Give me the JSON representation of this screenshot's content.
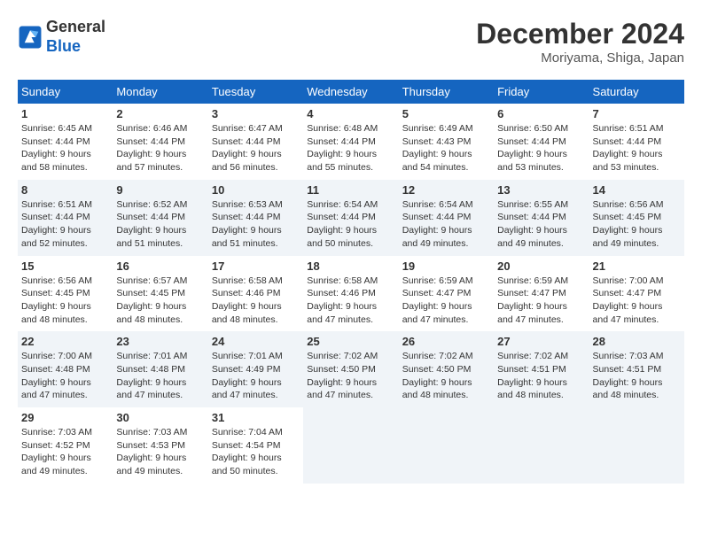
{
  "header": {
    "logo_line1": "General",
    "logo_line2": "Blue",
    "month_title": "December 2024",
    "location": "Moriyama, Shiga, Japan"
  },
  "weekdays": [
    "Sunday",
    "Monday",
    "Tuesday",
    "Wednesday",
    "Thursday",
    "Friday",
    "Saturday"
  ],
  "weeks": [
    [
      {
        "day": "1",
        "sunrise": "6:45 AM",
        "sunset": "4:44 PM",
        "daylight": "9 hours and 58 minutes."
      },
      {
        "day": "2",
        "sunrise": "6:46 AM",
        "sunset": "4:44 PM",
        "daylight": "9 hours and 57 minutes."
      },
      {
        "day": "3",
        "sunrise": "6:47 AM",
        "sunset": "4:44 PM",
        "daylight": "9 hours and 56 minutes."
      },
      {
        "day": "4",
        "sunrise": "6:48 AM",
        "sunset": "4:44 PM",
        "daylight": "9 hours and 55 minutes."
      },
      {
        "day": "5",
        "sunrise": "6:49 AM",
        "sunset": "4:43 PM",
        "daylight": "9 hours and 54 minutes."
      },
      {
        "day": "6",
        "sunrise": "6:50 AM",
        "sunset": "4:44 PM",
        "daylight": "9 hours and 53 minutes."
      },
      {
        "day": "7",
        "sunrise": "6:51 AM",
        "sunset": "4:44 PM",
        "daylight": "9 hours and 53 minutes."
      }
    ],
    [
      {
        "day": "8",
        "sunrise": "6:51 AM",
        "sunset": "4:44 PM",
        "daylight": "9 hours and 52 minutes."
      },
      {
        "day": "9",
        "sunrise": "6:52 AM",
        "sunset": "4:44 PM",
        "daylight": "9 hours and 51 minutes."
      },
      {
        "day": "10",
        "sunrise": "6:53 AM",
        "sunset": "4:44 PM",
        "daylight": "9 hours and 51 minutes."
      },
      {
        "day": "11",
        "sunrise": "6:54 AM",
        "sunset": "4:44 PM",
        "daylight": "9 hours and 50 minutes."
      },
      {
        "day": "12",
        "sunrise": "6:54 AM",
        "sunset": "4:44 PM",
        "daylight": "9 hours and 49 minutes."
      },
      {
        "day": "13",
        "sunrise": "6:55 AM",
        "sunset": "4:44 PM",
        "daylight": "9 hours and 49 minutes."
      },
      {
        "day": "14",
        "sunrise": "6:56 AM",
        "sunset": "4:45 PM",
        "daylight": "9 hours and 49 minutes."
      }
    ],
    [
      {
        "day": "15",
        "sunrise": "6:56 AM",
        "sunset": "4:45 PM",
        "daylight": "9 hours and 48 minutes."
      },
      {
        "day": "16",
        "sunrise": "6:57 AM",
        "sunset": "4:45 PM",
        "daylight": "9 hours and 48 minutes."
      },
      {
        "day": "17",
        "sunrise": "6:58 AM",
        "sunset": "4:46 PM",
        "daylight": "9 hours and 48 minutes."
      },
      {
        "day": "18",
        "sunrise": "6:58 AM",
        "sunset": "4:46 PM",
        "daylight": "9 hours and 47 minutes."
      },
      {
        "day": "19",
        "sunrise": "6:59 AM",
        "sunset": "4:47 PM",
        "daylight": "9 hours and 47 minutes."
      },
      {
        "day": "20",
        "sunrise": "6:59 AM",
        "sunset": "4:47 PM",
        "daylight": "9 hours and 47 minutes."
      },
      {
        "day": "21",
        "sunrise": "7:00 AM",
        "sunset": "4:47 PM",
        "daylight": "9 hours and 47 minutes."
      }
    ],
    [
      {
        "day": "22",
        "sunrise": "7:00 AM",
        "sunset": "4:48 PM",
        "daylight": "9 hours and 47 minutes."
      },
      {
        "day": "23",
        "sunrise": "7:01 AM",
        "sunset": "4:48 PM",
        "daylight": "9 hours and 47 minutes."
      },
      {
        "day": "24",
        "sunrise": "7:01 AM",
        "sunset": "4:49 PM",
        "daylight": "9 hours and 47 minutes."
      },
      {
        "day": "25",
        "sunrise": "7:02 AM",
        "sunset": "4:50 PM",
        "daylight": "9 hours and 47 minutes."
      },
      {
        "day": "26",
        "sunrise": "7:02 AM",
        "sunset": "4:50 PM",
        "daylight": "9 hours and 48 minutes."
      },
      {
        "day": "27",
        "sunrise": "7:02 AM",
        "sunset": "4:51 PM",
        "daylight": "9 hours and 48 minutes."
      },
      {
        "day": "28",
        "sunrise": "7:03 AM",
        "sunset": "4:51 PM",
        "daylight": "9 hours and 48 minutes."
      }
    ],
    [
      {
        "day": "29",
        "sunrise": "7:03 AM",
        "sunset": "4:52 PM",
        "daylight": "9 hours and 49 minutes."
      },
      {
        "day": "30",
        "sunrise": "7:03 AM",
        "sunset": "4:53 PM",
        "daylight": "9 hours and 49 minutes."
      },
      {
        "day": "31",
        "sunrise": "7:04 AM",
        "sunset": "4:54 PM",
        "daylight": "9 hours and 50 minutes."
      },
      null,
      null,
      null,
      null
    ]
  ]
}
